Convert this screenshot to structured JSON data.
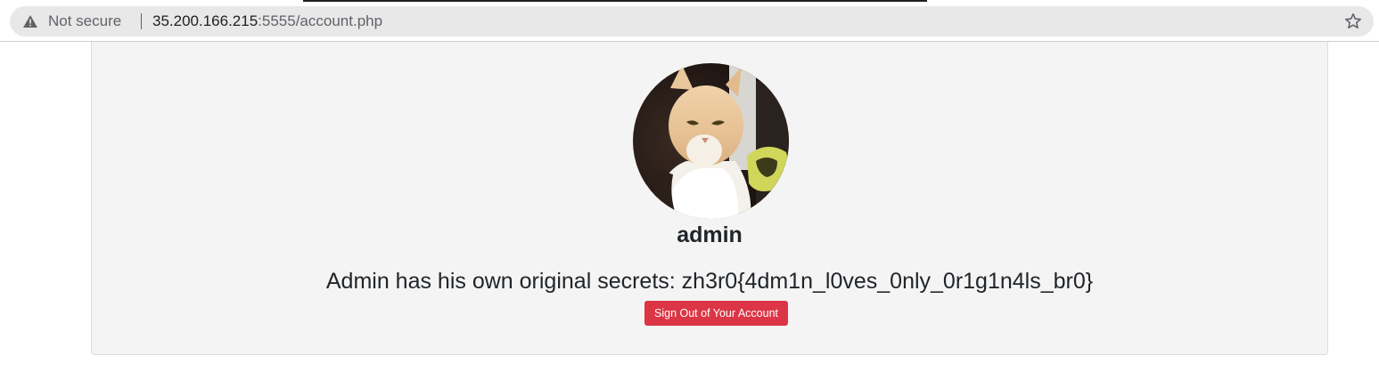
{
  "browser": {
    "security_label": "Not secure",
    "url_host": "35.200.166.215",
    "url_rest": ":5555/account.php",
    "icons": {
      "security": "warning-triangle-icon",
      "bookmark": "star-icon"
    }
  },
  "account": {
    "avatar_alt": "cat-avatar",
    "username": "admin",
    "secret_text": "Admin has his own original secrets: zh3r0{4dm1n_l0ves_0nly_0r1g1n4ls_br0}",
    "signout_label": "Sign Out of Your Account"
  },
  "colors": {
    "card_background": "#f4f4f4",
    "signout_button": "#dc3545",
    "text": "#212529"
  }
}
